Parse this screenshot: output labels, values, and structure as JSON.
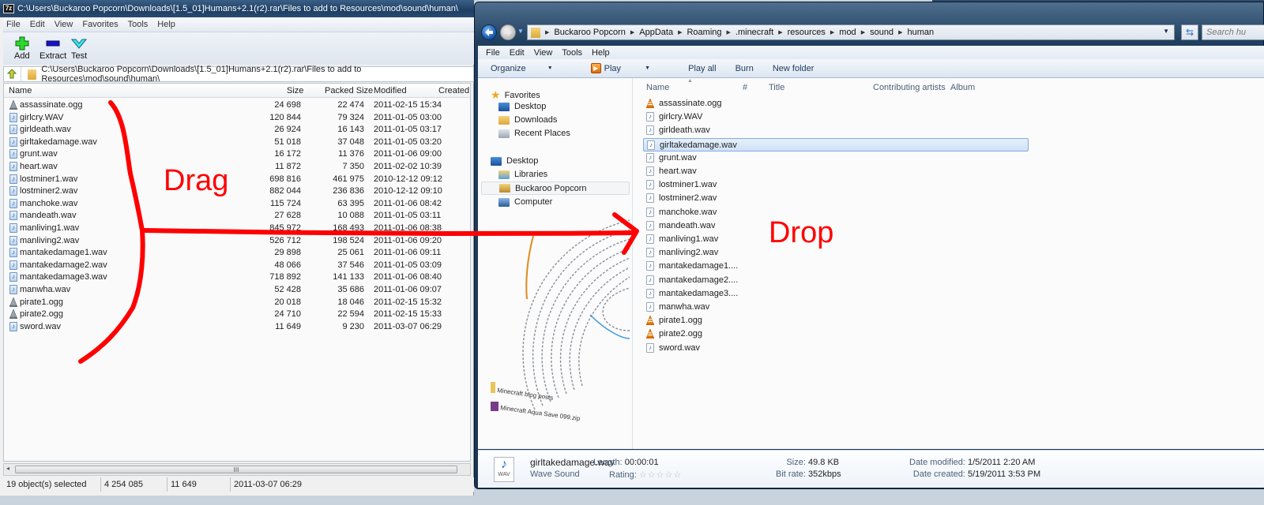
{
  "zip_window": {
    "title": "C:\\Users\\Buckaroo Popcorn\\Downloads\\[1.5_01]Humans+2.1(r2).rar\\Files to add to Resources\\mod\\sound\\human\\",
    "app_icon": "7z",
    "menu": [
      "File",
      "Edit",
      "View",
      "Favorites",
      "Tools",
      "Help"
    ],
    "toolbar": {
      "add": "Add",
      "extract": "Extract",
      "test": "Test"
    },
    "address": "C:\\Users\\Buckaroo Popcorn\\Downloads\\[1.5_01]Humans+2.1(r2).rar\\Files to add to Resources\\mod\\sound\\human\\",
    "columns": {
      "name": "Name",
      "size": "Size",
      "packed": "Packed Size",
      "modified": "Modified",
      "created": "Created"
    },
    "rows": [
      {
        "name": "assassinate.ogg",
        "type": "ogg",
        "size": "24 698",
        "packed": "22 474",
        "modified": "2011-02-15 15:34"
      },
      {
        "name": "girlcry.WAV",
        "type": "wav",
        "size": "120 844",
        "packed": "79 324",
        "modified": "2011-01-05 03:00"
      },
      {
        "name": "girldeath.wav",
        "type": "wav",
        "size": "26 924",
        "packed": "16 143",
        "modified": "2011-01-05 03:17"
      },
      {
        "name": "girltakedamage.wav",
        "type": "wav",
        "size": "51 018",
        "packed": "37 048",
        "modified": "2011-01-05 03:20"
      },
      {
        "name": "grunt.wav",
        "type": "wav",
        "size": "16 172",
        "packed": "11 376",
        "modified": "2011-01-06 09:00"
      },
      {
        "name": "heart.wav",
        "type": "wav",
        "size": "11 872",
        "packed": "7 350",
        "modified": "2011-02-02 10:39"
      },
      {
        "name": "lostminer1.wav",
        "type": "wav",
        "size": "698 816",
        "packed": "461 975",
        "modified": "2010-12-12 09:12"
      },
      {
        "name": "lostminer2.wav",
        "type": "wav",
        "size": "882 044",
        "packed": "236 836",
        "modified": "2010-12-12 09:10"
      },
      {
        "name": "manchoke.wav",
        "type": "wav",
        "size": "115 724",
        "packed": "63 395",
        "modified": "2011-01-06 08:42"
      },
      {
        "name": "mandeath.wav",
        "type": "wav",
        "size": "27 628",
        "packed": "10 088",
        "modified": "2011-01-05 03:11"
      },
      {
        "name": "manliving1.wav",
        "type": "wav",
        "size": "845 972",
        "packed": "168 493",
        "modified": "2011-01-06 08:38"
      },
      {
        "name": "manliving2.wav",
        "type": "wav",
        "size": "526 712",
        "packed": "198 524",
        "modified": "2011-01-06 09:20"
      },
      {
        "name": "mantakedamage1.wav",
        "type": "wav",
        "size": "29 898",
        "packed": "25 061",
        "modified": "2011-01-06 09:11"
      },
      {
        "name": "mantakedamage2.wav",
        "type": "wav",
        "size": "48 066",
        "packed": "37 546",
        "modified": "2011-01-05 03:09"
      },
      {
        "name": "mantakedamage3.wav",
        "type": "wav",
        "size": "718 892",
        "packed": "141 133",
        "modified": "2011-01-06 08:40"
      },
      {
        "name": "manwha.wav",
        "type": "wav",
        "size": "52 428",
        "packed": "35 686",
        "modified": "2011-01-06 09:07"
      },
      {
        "name": "pirate1.ogg",
        "type": "ogg",
        "size": "20 018",
        "packed": "18 046",
        "modified": "2011-02-15 15:32"
      },
      {
        "name": "pirate2.ogg",
        "type": "ogg",
        "size": "24 710",
        "packed": "22 594",
        "modified": "2011-02-15 15:33"
      },
      {
        "name": "sword.wav",
        "type": "wav",
        "size": "11 649",
        "packed": "9 230",
        "modified": "2011-03-07 06:29"
      }
    ],
    "scroll_glyph": "III",
    "status": {
      "selected": "19 object(s) selected",
      "total_size": "4 254 085",
      "selected_size": "11 649",
      "date": "2011-03-07 06:29"
    }
  },
  "explorer_window": {
    "breadcrumb": [
      "Buckaroo Popcorn",
      "AppData",
      "Roaming",
      ".minecraft",
      "resources",
      "mod",
      "sound",
      "human"
    ],
    "search_placeholder": "Search hu",
    "menu": [
      "File",
      "Edit",
      "View",
      "Tools",
      "Help"
    ],
    "commands": {
      "organize": "Organize",
      "play": "Play",
      "play_all": "Play all",
      "burn": "Burn",
      "new_folder": "New folder"
    },
    "nav": {
      "favorites": "Favorites",
      "fav_items": [
        "Desktop",
        "Downloads",
        "Recent Places"
      ],
      "desktop": "Desktop",
      "desktop_items": [
        "Libraries",
        "Buckaroo Popcorn",
        "Computer"
      ]
    },
    "background_labels": [
      "Minecraft blog posts",
      "Minecraft Aqua Save 099.zip"
    ],
    "columns": {
      "name": "Name",
      "number": "#",
      "title": "Title",
      "artists": "Contributing artists",
      "album": "Album"
    },
    "files": [
      {
        "name": "assassinate.ogg",
        "type": "ogg"
      },
      {
        "name": "girlcry.WAV",
        "type": "wav"
      },
      {
        "name": "girldeath.wav",
        "type": "wav"
      },
      {
        "name": "girltakedamage.wav",
        "type": "wav",
        "selected": true
      },
      {
        "name": "grunt.wav",
        "type": "wav"
      },
      {
        "name": "heart.wav",
        "type": "wav"
      },
      {
        "name": "lostminer1.wav",
        "type": "wav"
      },
      {
        "name": "lostminer2.wav",
        "type": "wav"
      },
      {
        "name": "manchoke.wav",
        "type": "wav"
      },
      {
        "name": "mandeath.wav",
        "type": "wav"
      },
      {
        "name": "manliving1.wav",
        "type": "wav"
      },
      {
        "name": "manliving2.wav",
        "type": "wav"
      },
      {
        "name": "mantakedamage1....",
        "type": "wav"
      },
      {
        "name": "mantakedamage2....",
        "type": "wav"
      },
      {
        "name": "mantakedamage3....",
        "type": "wav"
      },
      {
        "name": "manwha.wav",
        "type": "wav"
      },
      {
        "name": "pirate1.ogg",
        "type": "ogg"
      },
      {
        "name": "pirate2.ogg",
        "type": "ogg"
      },
      {
        "name": "sword.wav",
        "type": "wav"
      }
    ],
    "details": {
      "filename": "girltakedamage.wav",
      "filetype": "Wave Sound",
      "icon_label": "WAV",
      "length_label": "Length:",
      "length": "00:00:01",
      "rating_label": "Rating:",
      "rating_stars": "☆☆☆☆☆",
      "rating_value": 0,
      "size_label": "Size:",
      "size": "49.8 KB",
      "bitrate_label": "Bit rate:",
      "bitrate": "352kbps",
      "modified_label": "Date modified:",
      "modified": "1/5/2011 2:20 AM",
      "created_label": "Date created:",
      "created": "5/19/2011 3:53 PM"
    }
  },
  "annotations": {
    "drag": "Drag",
    "drop": "Drop",
    "color": "#ff0000"
  }
}
